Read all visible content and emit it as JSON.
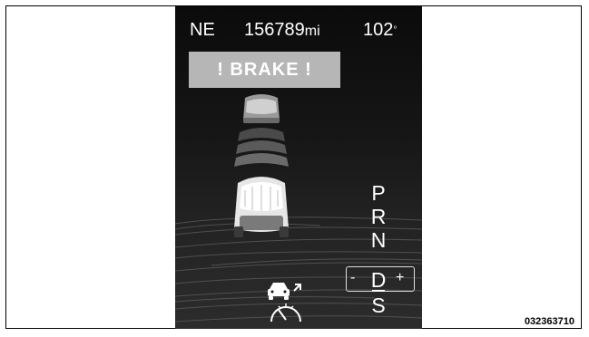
{
  "status_bar": {
    "compass": "NE",
    "odometer": "156789",
    "odometer_unit": "mi",
    "temperature": "102",
    "temperature_symbol": "°"
  },
  "warning": {
    "text": "! BRAKE !"
  },
  "gear_selector": {
    "gears": [
      "P",
      "R",
      "N",
      "D",
      "S"
    ],
    "active": "D",
    "minus": "-",
    "plus": "+"
  },
  "icons": {
    "collision_warning": "forward-collision-car-icon",
    "adaptive_cruise": "speedometer-icon"
  },
  "figure_code": "032363710",
  "colors": {
    "screen_bg": "#111111",
    "warning_bg": "#b6b6b6",
    "text": "#ffffff"
  }
}
